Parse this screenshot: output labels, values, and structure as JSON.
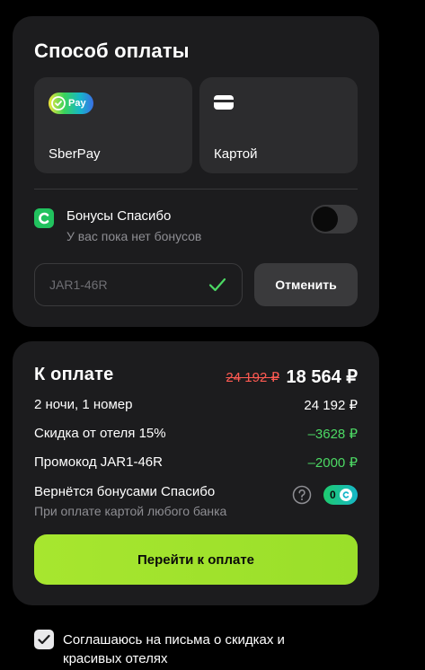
{
  "payment": {
    "title": "Способ оплаты",
    "methods": [
      {
        "label": "SberPay",
        "icon": "sberpay-logo",
        "badge_text": "Pay"
      },
      {
        "label": "Картой",
        "icon": "credit-card-icon"
      }
    ],
    "bonus": {
      "title": "Бонусы Спасибо",
      "subtitle": "У вас пока нет бонусов",
      "toggle_on": false
    },
    "promo": {
      "value": "JAR1-46R",
      "applied": true,
      "cancel_label": "Отменить"
    }
  },
  "summary": {
    "title": "К оплате",
    "old_total": "24 192 ₽",
    "total": "18 564 ₽",
    "rows": [
      {
        "label": "2 ночи, 1 номер",
        "value": "24 192 ₽"
      },
      {
        "label": "Скидка от отеля 15%",
        "value": "–3628 ₽"
      },
      {
        "label": "Промокод JAR1-46R",
        "value": "–2000 ₽"
      }
    ],
    "cashback": {
      "label": "Вернётся бонусами Спасибо",
      "note": "При оплате картой любого банка",
      "amount": "0"
    },
    "cta_label": "Перейти к оплате"
  },
  "consent": {
    "checked": true,
    "text": "Соглашаюсь на письма о скидках и красивых отелях"
  },
  "colors": {
    "accent": "#a6e22e",
    "discount": "#4cd964",
    "old_price": "#ff5a52",
    "card_bg": "#1c1c1e"
  }
}
